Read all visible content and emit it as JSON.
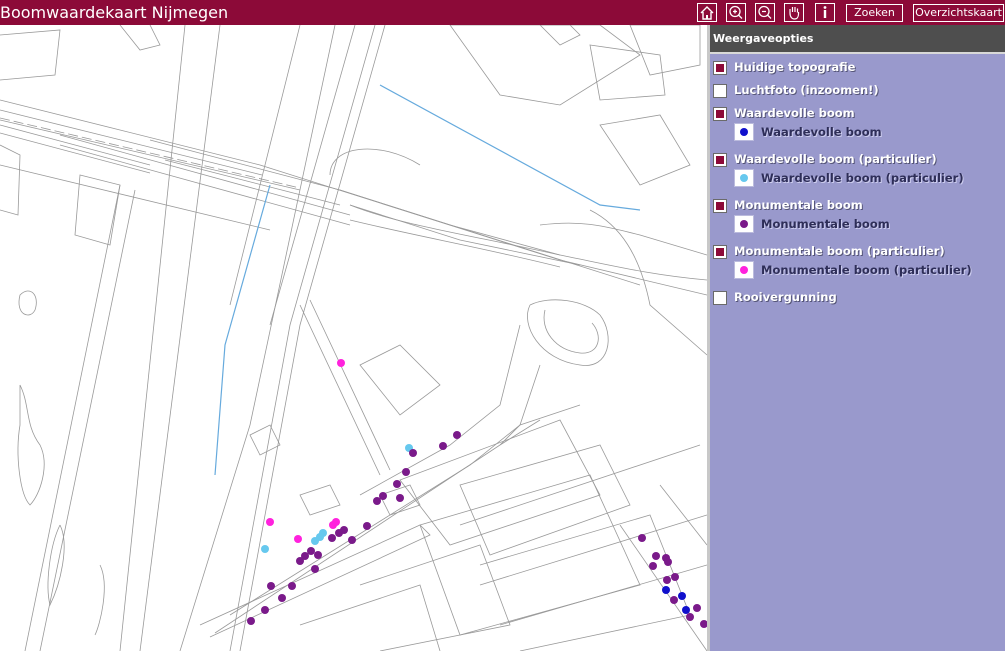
{
  "app": {
    "title": "Boomwaardekaart Nijmegen"
  },
  "toolbar": {
    "icons": [
      "home-icon",
      "zoom-in-icon",
      "zoom-out-icon",
      "pan-hand-icon",
      "info-icon"
    ],
    "search_label": "Zoeken",
    "overview_label": "Overzichtskaart"
  },
  "panel": {
    "title": "Weergaveopties",
    "layers": [
      {
        "label": "Huidige topografie",
        "checked": true
      },
      {
        "label": "Luchtfoto (inzoomen!)",
        "checked": false
      },
      {
        "label": "Waardevolle boom",
        "checked": true,
        "legend_label": "Waardevolle boom",
        "legend_color": "#1010cc"
      },
      {
        "label": "Waardevolle boom (particulier)",
        "checked": true,
        "legend_label": "Waardevolle boom (particulier)",
        "legend_color": "#66c8ee"
      },
      {
        "label": "Monumentale boom",
        "checked": true,
        "legend_label": "Monumentale boom",
        "legend_color": "#7a1a8a"
      },
      {
        "label": "Monumentale boom (particulier)",
        "checked": true,
        "legend_label": "Monumentale boom (particulier)",
        "legend_color": "#ff22dd"
      },
      {
        "label": "Rooivergunning",
        "checked": false
      }
    ]
  },
  "colors": {
    "titlebar": "#8c0a38",
    "panel": "#9999cc",
    "checked": "#8c0a38"
  }
}
